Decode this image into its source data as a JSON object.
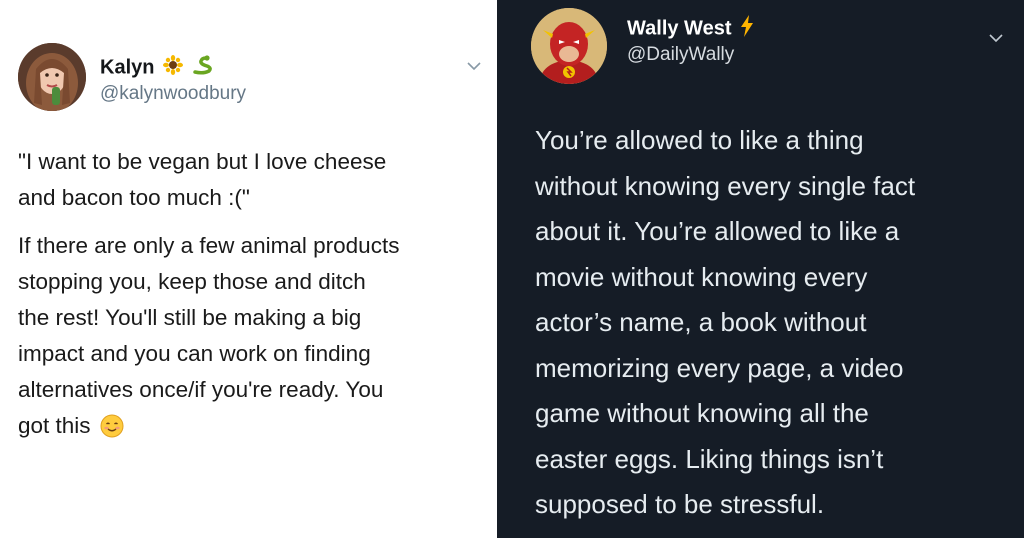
{
  "tweets": [
    {
      "theme": "light",
      "author": {
        "name": "Kalyn",
        "handle": "@kalynwoodbury",
        "name_emojis": [
          "sunflower-icon",
          "snake-icon"
        ]
      },
      "paragraphs": [
        [
          "\"I want to be vegan but I love cheese",
          "and bacon too much :(\""
        ],
        [
          "If there are only a few animal products",
          "stopping you, keep those and ditch",
          "the rest! You'll still be making a big",
          "impact and you can work on finding",
          "alternatives once/if you're ready. You",
          "got this"
        ]
      ],
      "trailing_emoji": "smiling-face-icon",
      "colors": {
        "background": "#ffffff",
        "text": "#1a1a1a",
        "handle": "#657786"
      }
    },
    {
      "theme": "dark",
      "author": {
        "name": "Wally West",
        "handle": "@DailyWally",
        "name_emojis": [
          "lightning-icon"
        ]
      },
      "paragraphs": [
        [
          "You’re allowed to like a thing",
          "without knowing every single fact",
          "about it. You’re allowed to like a",
          "movie without knowing every",
          "actor’s name, a book without",
          "memorizing every page, a video",
          "game without knowing all the",
          "easter eggs. Liking things isn’t",
          "supposed to be stressful."
        ]
      ],
      "colors": {
        "background": "#151c26",
        "text": "#e6ecf0",
        "handle": "#d6dbe0"
      }
    }
  ]
}
